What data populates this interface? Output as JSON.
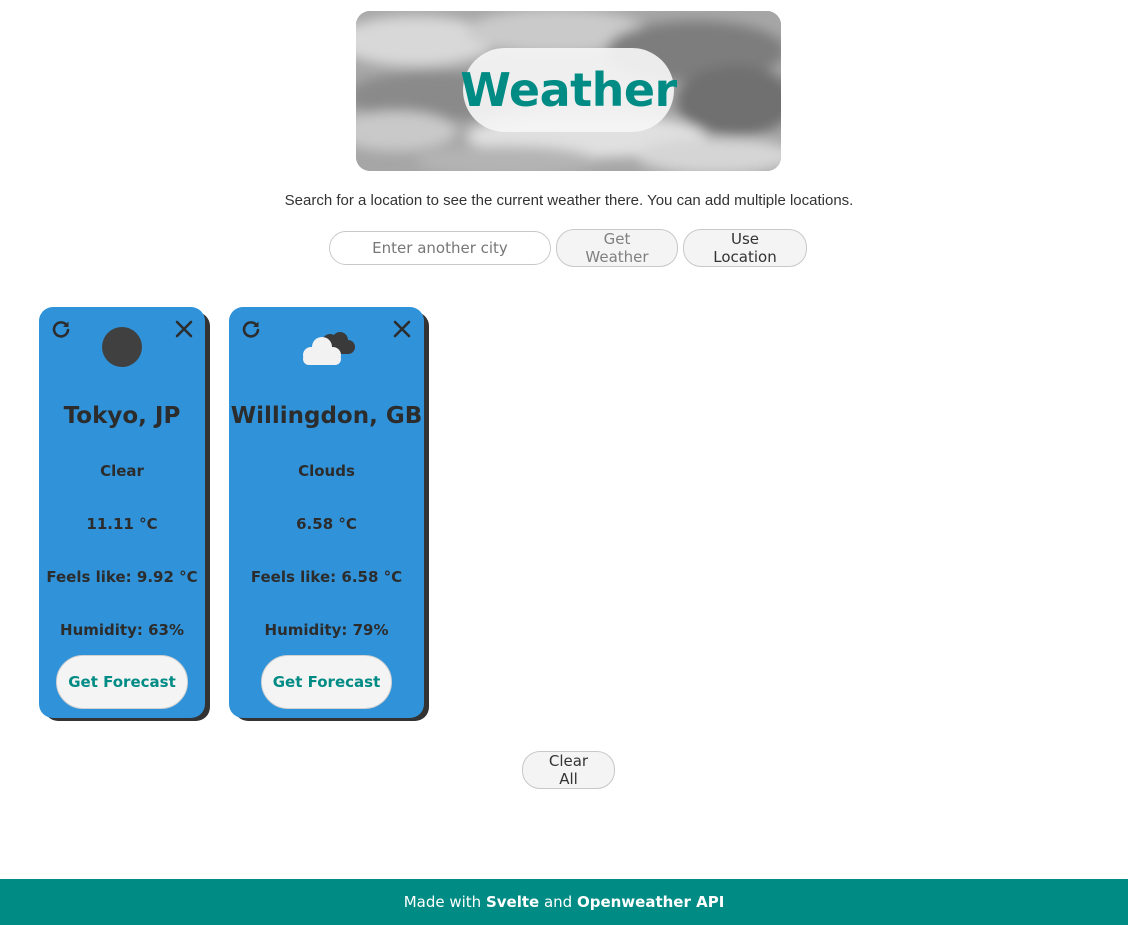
{
  "header": {
    "title": "Weather"
  },
  "intro": "Search for a location to see the current weather there. You can add multiple locations.",
  "search": {
    "placeholder": "Enter another city",
    "value": "",
    "get_weather_label": "Get Weather",
    "use_location_label": "Use Location"
  },
  "cards": [
    {
      "city": "Tokyo, JP",
      "condition": "Clear",
      "temperature": "11.11 °C",
      "feels_like": "Feels like: 9.92 °C",
      "humidity": "Humidity: 63%",
      "forecast_label": "Get Forecast",
      "icon": "clear-moon-icon"
    },
    {
      "city": "Willingdon, GB",
      "condition": "Clouds",
      "temperature": "6.58 °C",
      "feels_like": "Feels like: 6.58 °C",
      "humidity": "Humidity: 79%",
      "forecast_label": "Get Forecast",
      "icon": "clouds-icon"
    }
  ],
  "clear_all_label": "Clear All",
  "footer": {
    "prefix": "Made with ",
    "svelte": "Svelte",
    "middle": " and ",
    "api": "Openweather API"
  },
  "colors": {
    "accent": "#008b84",
    "card": "#3093d9",
    "card_shadow": "#333333"
  }
}
